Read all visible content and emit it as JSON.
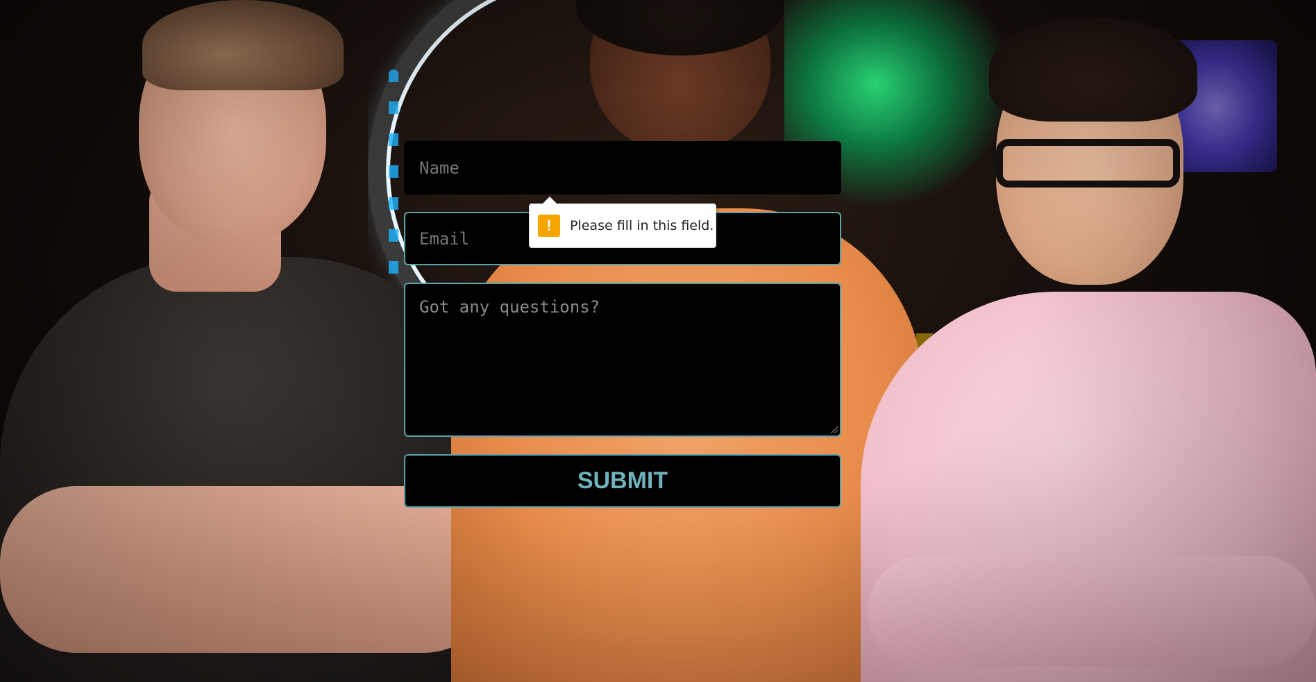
{
  "form": {
    "name_placeholder": "Name",
    "email_placeholder": "Email",
    "questions_placeholder": "Got any questions?",
    "submit_label": "SUBMIT"
  },
  "validation": {
    "message": "Please fill in this field.",
    "icon": "warning-icon",
    "icon_glyph": "!"
  },
  "colors": {
    "field_background": "#000000",
    "field_border": "#5ba3ad",
    "submit_text": "#6eb3bd",
    "warning": "#f5a400"
  }
}
